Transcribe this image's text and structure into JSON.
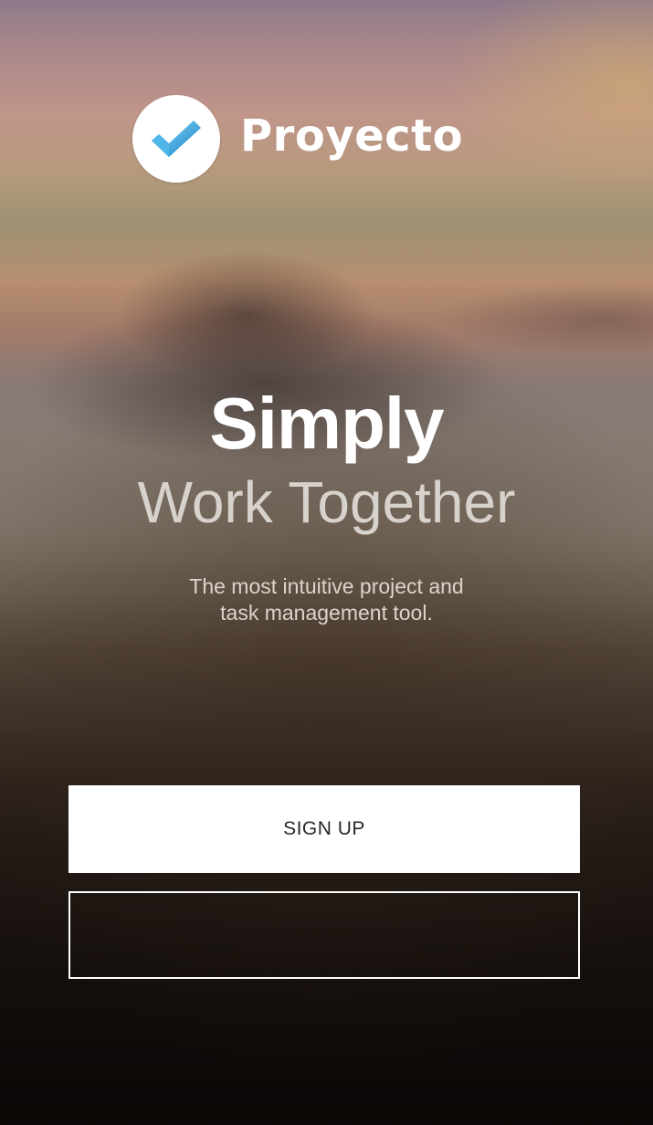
{
  "brand": {
    "name": "Proyecto",
    "logo_icon": "check-icon",
    "logo_colors": {
      "background": "#ffffff",
      "check_light": "#6fd3f5",
      "check_dark": "#1f7fc9"
    }
  },
  "hero": {
    "headline": "Simply",
    "subheadline": "Work Together",
    "tagline_lines": [
      "The most intuitive project and",
      "task management tool."
    ]
  },
  "actions": {
    "signup_label": "SIGN UP",
    "second_label": ""
  },
  "colors": {
    "button_primary_bg": "#ffffff",
    "button_primary_text": "#2b2624",
    "outline_border": "#ffffff"
  }
}
